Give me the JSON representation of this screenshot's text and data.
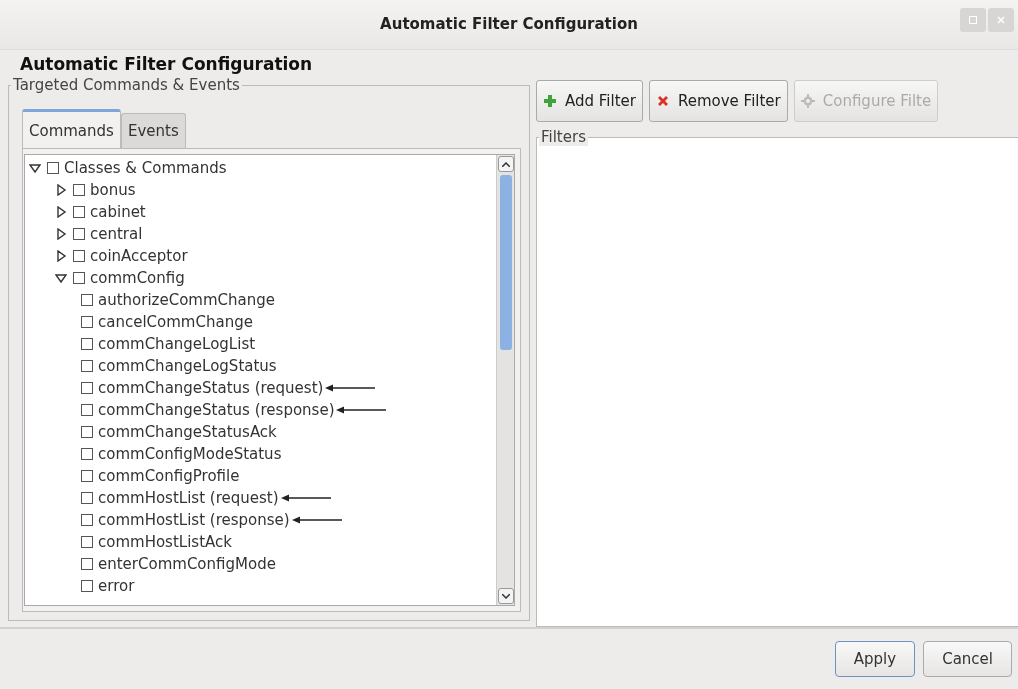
{
  "window": {
    "title": "Automatic Filter Configuration"
  },
  "heading": "Automatic Filter Configuration",
  "left_panel": {
    "legend": "Targeted Commands & Events",
    "tabs": [
      {
        "label": "Commands",
        "selected": true
      },
      {
        "label": "Events",
        "selected": false
      }
    ],
    "tree": [
      {
        "label": "Classes & Commands",
        "checked": false,
        "expanded": true,
        "children": [
          {
            "label": "bonus",
            "checked": false,
            "expanded": false
          },
          {
            "label": "cabinet",
            "checked": false,
            "expanded": false
          },
          {
            "label": "central",
            "checked": false,
            "expanded": false
          },
          {
            "label": "coinAcceptor",
            "checked": false,
            "expanded": false
          },
          {
            "label": "commConfig",
            "checked": false,
            "expanded": true,
            "children": [
              {
                "label": "authorizeCommChange",
                "checked": false,
                "arrow": false
              },
              {
                "label": "cancelCommChange",
                "checked": false,
                "arrow": false
              },
              {
                "label": "commChangeLogList",
                "checked": false,
                "arrow": false
              },
              {
                "label": "commChangeLogStatus",
                "checked": false,
                "arrow": false
              },
              {
                "label": "commChangeStatus (request)",
                "checked": false,
                "arrow": true
              },
              {
                "label": "commChangeStatus (response)",
                "checked": false,
                "arrow": true
              },
              {
                "label": "commChangeStatusAck",
                "checked": false,
                "arrow": false
              },
              {
                "label": "commConfigModeStatus",
                "checked": false,
                "arrow": false
              },
              {
                "label": "commConfigProfile",
                "checked": false,
                "arrow": false
              },
              {
                "label": "commHostList (request)",
                "checked": false,
                "arrow": true
              },
              {
                "label": "commHostList (response)",
                "checked": false,
                "arrow": true
              },
              {
                "label": "commHostListAck",
                "checked": false,
                "arrow": false
              },
              {
                "label": "enterCommConfigMode",
                "checked": false,
                "arrow": false
              },
              {
                "label": "error",
                "checked": false,
                "arrow": false
              }
            ]
          }
        ]
      }
    ]
  },
  "toolbar": [
    {
      "label": "Add Filter",
      "kind": "add",
      "disabled": false
    },
    {
      "label": "Remove Filter",
      "kind": "remove",
      "disabled": false
    },
    {
      "label": "Configure Filte",
      "kind": "configure",
      "disabled": true
    }
  ],
  "filters": {
    "legend": "Filters"
  },
  "buttons": [
    {
      "label": "Apply",
      "kind": "default"
    },
    {
      "label": "Cancel",
      "kind": "normal"
    }
  ]
}
